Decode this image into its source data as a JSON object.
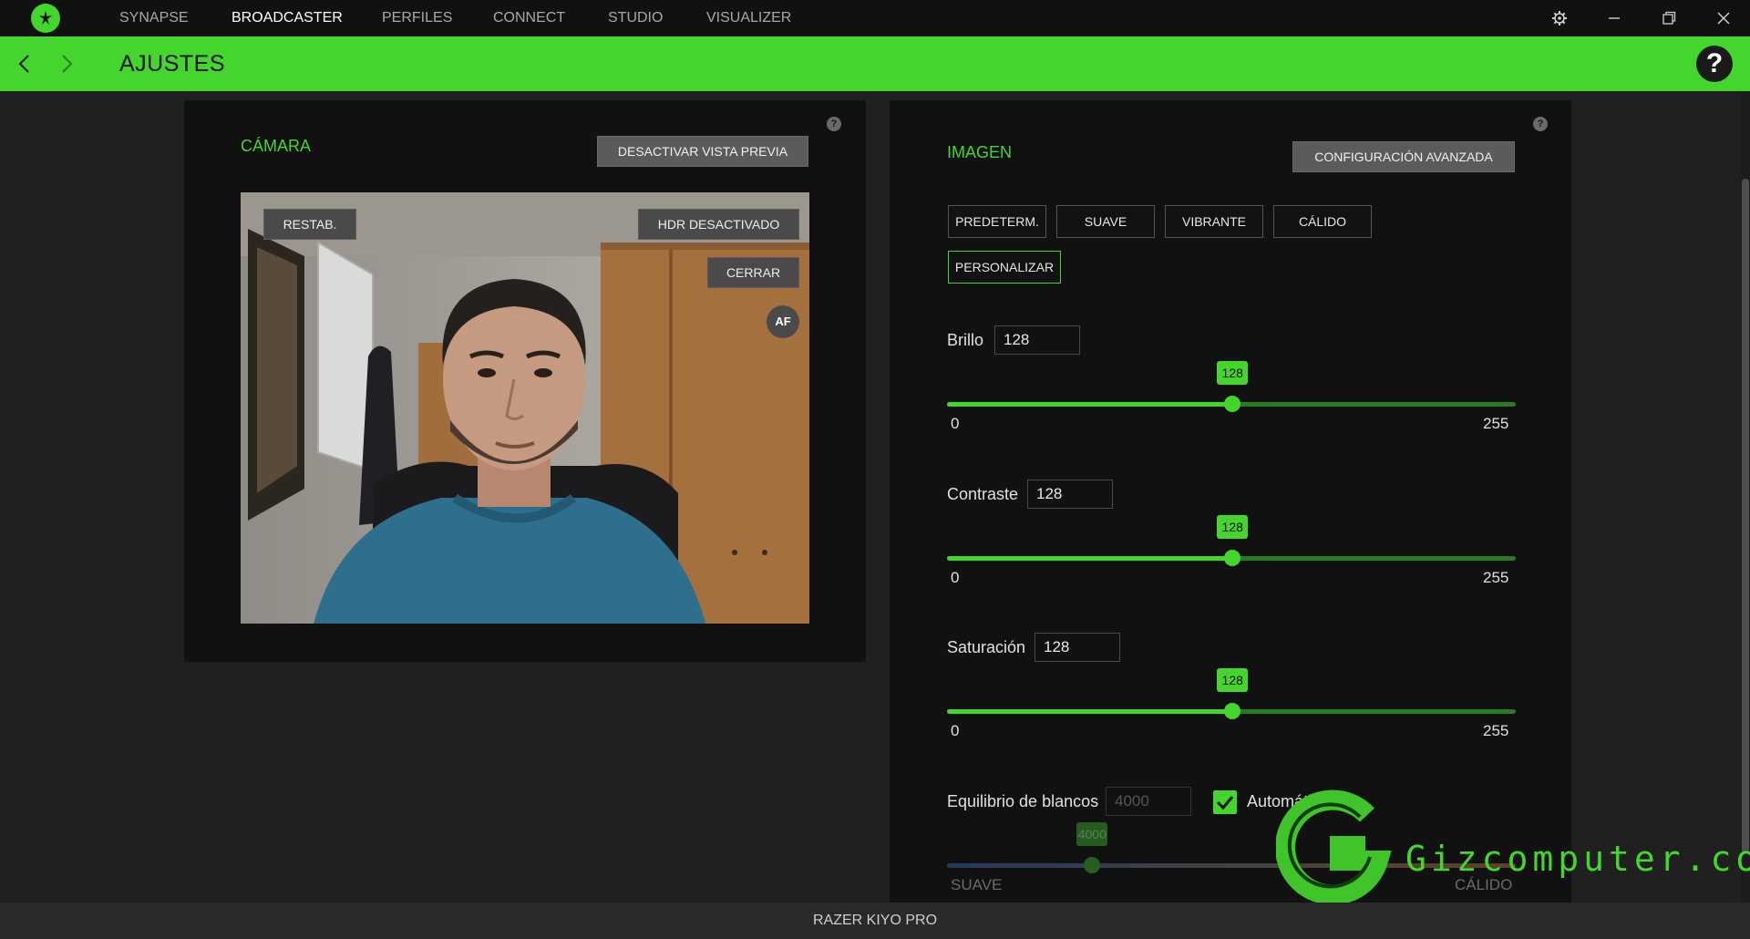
{
  "nav": {
    "tabs": [
      {
        "label": "SYNAPSE"
      },
      {
        "label": "BROADCASTER"
      },
      {
        "label": "PERFILES"
      },
      {
        "label": "CONNECT"
      },
      {
        "label": "STUDIO"
      },
      {
        "label": "VISUALIZER"
      }
    ],
    "active_tab": "BROADCASTER"
  },
  "header": {
    "title": "AJUSTES",
    "help": "?"
  },
  "camera": {
    "title": "CÁMARA",
    "preview_button": "DESACTIVAR VISTA PREVIA",
    "help": "?",
    "reset_button": "RESTAB.",
    "hdr_button": "HDR DESACTIVADO",
    "close_button": "CERRAR",
    "af_button": "AF"
  },
  "image": {
    "title": "IMAGEN",
    "help": "?",
    "advanced_button": "CONFIGURACIÓN AVANZADA",
    "presets": [
      "PREDETERM.",
      "SUAVE",
      "VIBRANTE",
      "CÁLIDO",
      "PERSONALIZAR"
    ],
    "active_preset": "PERSONALIZAR",
    "sliders": [
      {
        "label": "Brillo",
        "value": "128",
        "min": "0",
        "max": "255"
      },
      {
        "label": "Contraste",
        "value": "128",
        "min": "0",
        "max": "255"
      },
      {
        "label": "Saturación",
        "value": "128",
        "min": "0",
        "max": "255"
      }
    ],
    "white_balance": {
      "label": "Equilibrio de blancos",
      "value": "4000",
      "min_value": 2800,
      "max_value": 7500,
      "auto_label": "Automático",
      "auto_checked": true,
      "min_label": "SUAVE",
      "max_label": "CÁLIDO"
    }
  },
  "footer": {
    "device": "RAZER KIYO PRO"
  },
  "watermark": {
    "text": "Gizcomputer.com"
  },
  "colors": {
    "accent": "#44d62c",
    "panel": "#111111",
    "background": "#202020"
  }
}
